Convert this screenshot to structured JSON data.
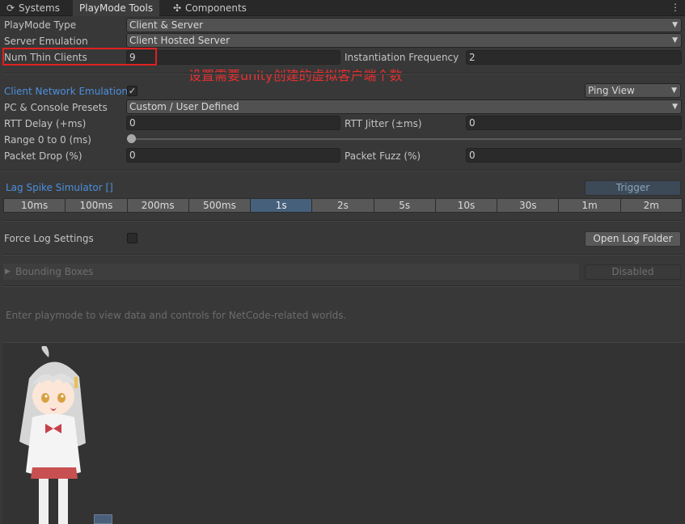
{
  "tabs": [
    {
      "label": "Systems",
      "icon": "refresh-icon"
    },
    {
      "label": "PlayMode Tools",
      "active": true
    },
    {
      "label": "Components",
      "icon": "puzzle-icon"
    }
  ],
  "menu_icon": "⋮",
  "playmode_type": {
    "label": "PlayMode Type",
    "value": "Client & Server"
  },
  "server_emulation": {
    "label": "Server Emulation",
    "value": "Client Hosted Server"
  },
  "num_thin_clients": {
    "label": "Num Thin Clients",
    "value": "9"
  },
  "instantiation_frequency": {
    "label": "Instantiation Frequency",
    "value": "2"
  },
  "annotation": "设置需要unity创建的虚拟客户端个数",
  "network_emulation": {
    "label": "Client Network Emulation",
    "checked": true,
    "check_glyph": "✓",
    "view_value": "Ping View"
  },
  "presets": {
    "label": "PC & Console Presets",
    "value": "Custom / User Defined"
  },
  "rtt_delay": {
    "label": "RTT Delay (+ms)",
    "value": "0"
  },
  "rtt_jitter": {
    "label": "RTT Jitter (±ms)",
    "value": "0"
  },
  "range": {
    "label": "Range 0 to 0 (ms)",
    "slider_fraction": 0
  },
  "packet_drop": {
    "label": "Packet Drop (%)",
    "value": "0"
  },
  "packet_fuzz": {
    "label": "Packet Fuzz (%)",
    "value": "0"
  },
  "lag_spike": {
    "label": "Lag Spike Simulator []",
    "trigger_label": "Trigger",
    "options": [
      "10ms",
      "100ms",
      "200ms",
      "500ms",
      "1s",
      "2s",
      "5s",
      "10s",
      "30s",
      "1m",
      "2m"
    ],
    "selected": "1s"
  },
  "force_log": {
    "label": "Force Log Settings",
    "checked": false,
    "open_folder_label": "Open Log Folder"
  },
  "bounding_boxes": {
    "label": "Bounding Boxes",
    "state_label": "Disabled"
  },
  "info_text": "Enter playmode to view data and controls for NetCode-related worlds.",
  "colors": {
    "accent": "#4c8fdc",
    "annotation": "#e83030",
    "selected_spike": "#46607c"
  }
}
